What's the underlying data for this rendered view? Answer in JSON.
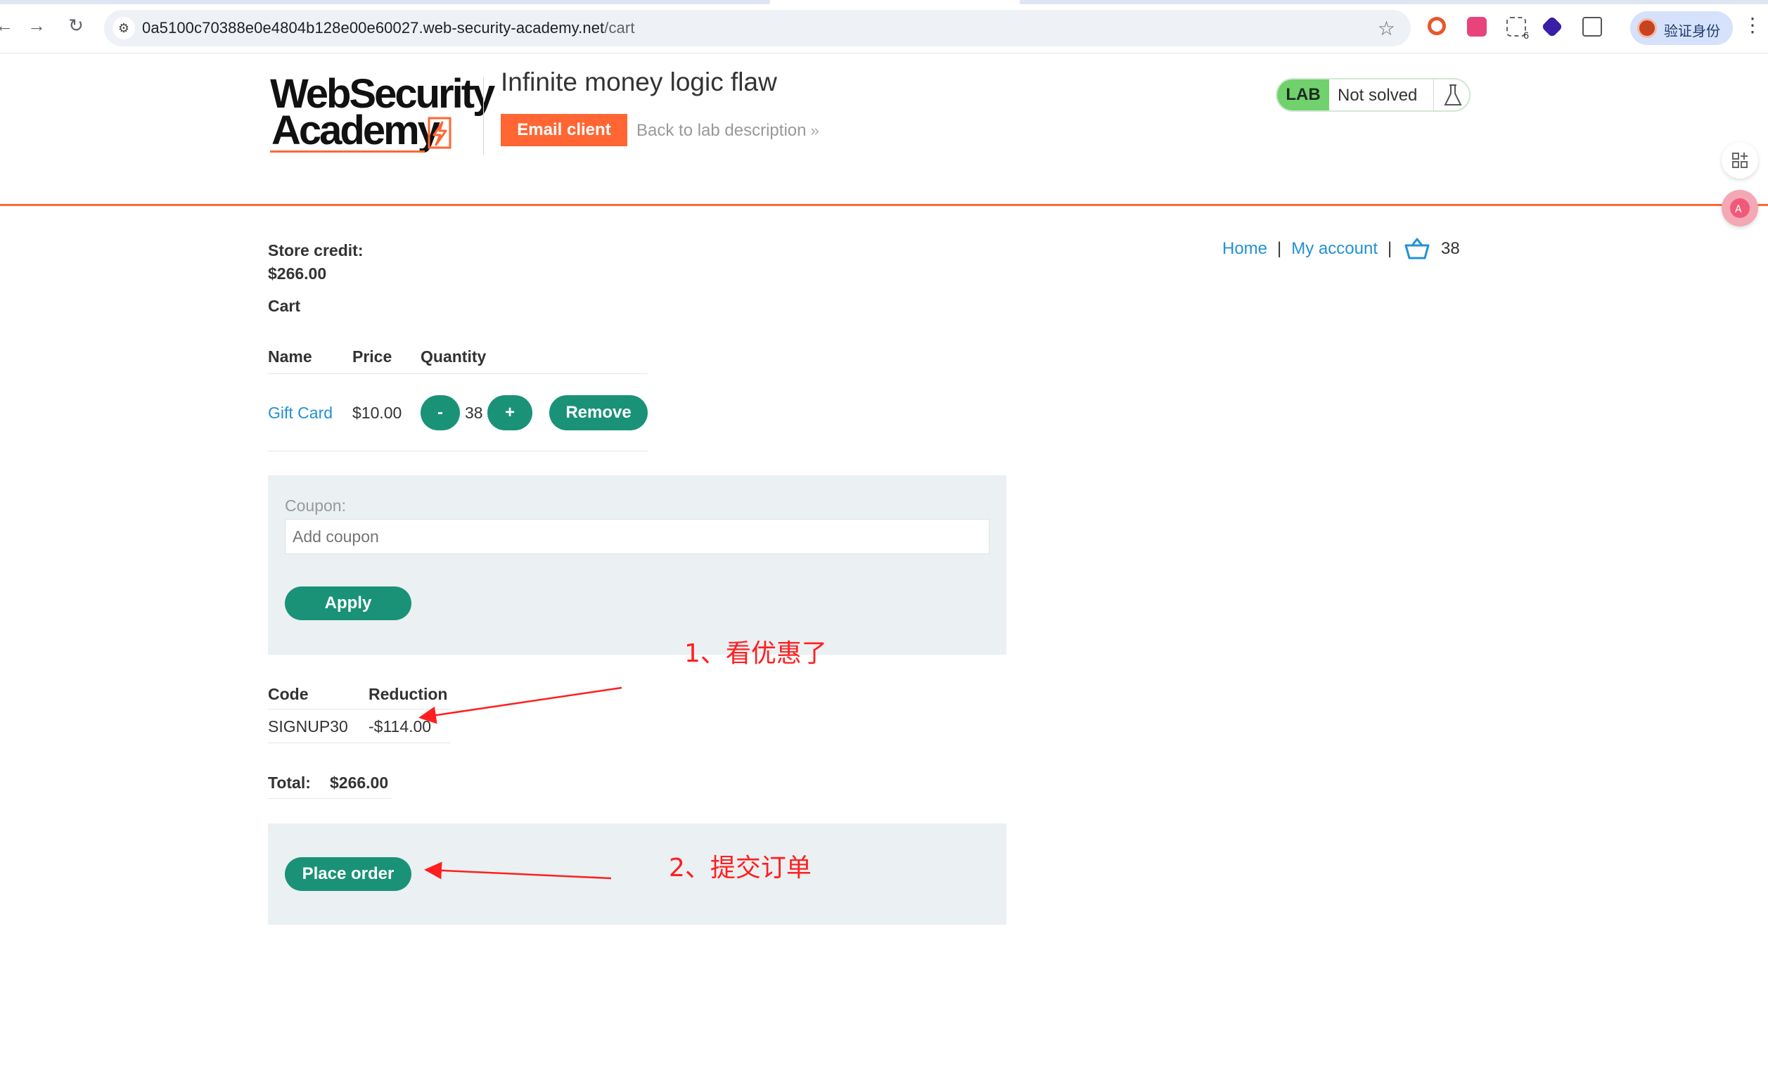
{
  "browser": {
    "url_host": "0a5100c70388e0e4804b128e00e60027.web-security-academy.net",
    "url_path": "/cart",
    "profile_label": "验证身份",
    "extension_badge": "6"
  },
  "header": {
    "logo_line1": "WebSecurity",
    "logo_line2": "Academy",
    "lab_title": "Infinite money logic flaw",
    "email_client_label": "Email client",
    "back_link_label": "Back to lab description",
    "back_link_chevron": "»",
    "lab_badge": "LAB",
    "lab_state": "Not solved"
  },
  "nav": {
    "home": "Home",
    "separator": "|",
    "my_account": "My account",
    "basket_count": "38"
  },
  "store_credit": {
    "label": "Store credit:",
    "value": "$266.00"
  },
  "cart": {
    "heading": "Cart",
    "columns": [
      "Name",
      "Price",
      "Quantity"
    ],
    "items": [
      {
        "name": "Gift Card",
        "price": "$10.00",
        "minus": "-",
        "quantity": "38",
        "plus": "+",
        "remove": "Remove"
      }
    ]
  },
  "coupon": {
    "label": "Coupon:",
    "placeholder": "Add coupon",
    "apply_label": "Apply"
  },
  "reductions": {
    "columns": [
      "Code",
      "Reduction"
    ],
    "rows": [
      {
        "code": "SIGNUP30",
        "reduction": "-$114.00"
      }
    ]
  },
  "total": {
    "label": "Total:",
    "value": "$266.00"
  },
  "place_order_label": "Place order",
  "annotations": {
    "note1": "1、看优惠了",
    "note2": "2、提交订单",
    "color": "#ff1f1f"
  },
  "colors": {
    "accent_orange": "#ff6633",
    "button_green": "#1a9277",
    "link_blue": "#2391d3",
    "lab_green": "#70d16d"
  }
}
